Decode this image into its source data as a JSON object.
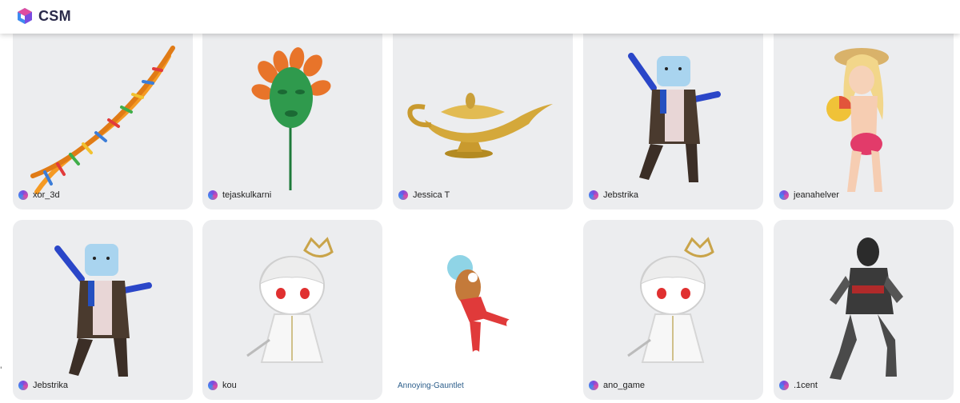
{
  "app": {
    "logo_text": "CSM",
    "logo_icon": "csm-cube-logo-icon"
  },
  "gallery": {
    "row1": [
      {
        "author": "xor_3d",
        "subject": "dna-helix"
      },
      {
        "author": "tejaskulkarni",
        "subject": "green-mask-with-leaves"
      },
      {
        "author": "Jessica T",
        "subject": "golden-lamp"
      },
      {
        "author": "Jebstrika",
        "subject": "teapot-head-dancer"
      },
      {
        "author": "jeanahelver",
        "subject": "anime-beach-girl"
      }
    ],
    "row2": [
      {
        "author": "Jebstrika",
        "subject": "teapot-head-dancer"
      },
      {
        "author": "kou",
        "subject": "chibi-crowned-character"
      },
      {
        "author": "Annoying-Gauntlet",
        "subject": "jumping-toy-figure"
      },
      {
        "author": "ano_game",
        "subject": "chibi-crowned-character"
      },
      {
        "author": ".1cent",
        "subject": "armored-soldier"
      }
    ]
  },
  "edge_glyph": "'",
  "colors": {
    "card_bg": "#ecedef",
    "header_bg": "#ffffff",
    "text": "#222222",
    "link": "#2b5d8a"
  }
}
